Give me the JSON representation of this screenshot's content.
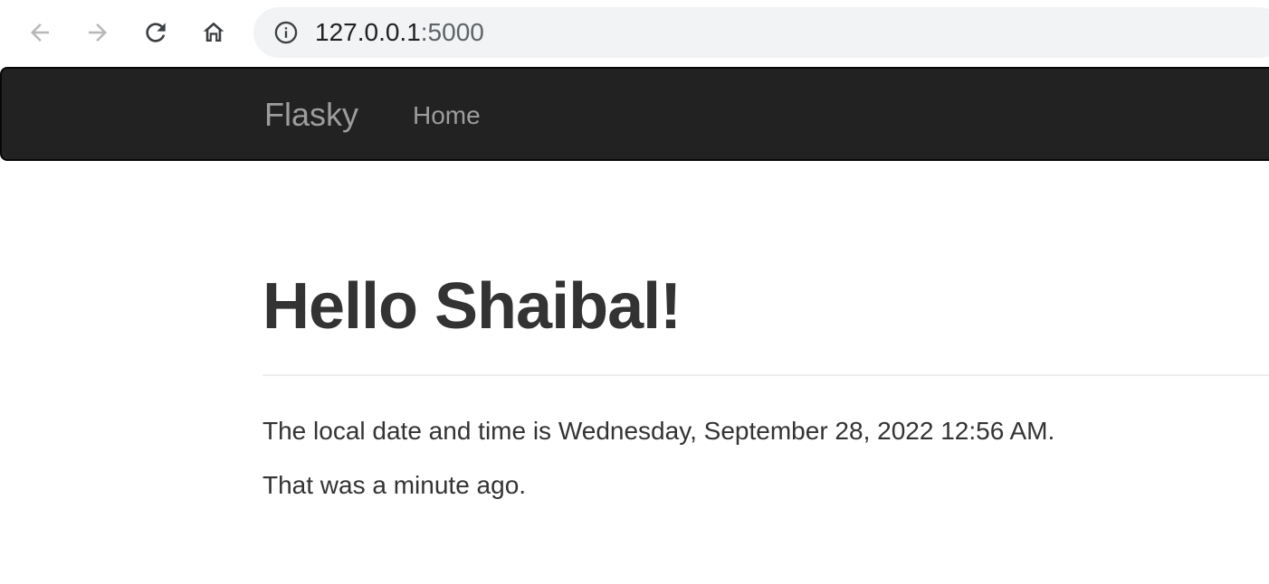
{
  "browser": {
    "url_host": "127.0.0.1",
    "url_port": ":5000",
    "icons": {
      "back": "arrow-left-icon",
      "forward": "arrow-right-icon",
      "reload": "reload-icon",
      "home": "home-icon",
      "info": "info-icon"
    }
  },
  "navbar": {
    "brand": "Flasky",
    "links": [
      {
        "label": "Home"
      }
    ],
    "background": "#222222"
  },
  "main": {
    "heading": "Hello Shaibal!",
    "local_time_text": "The local date and time is Wednesday, September 28, 2022 12:56 AM.",
    "relative_time_text": "That was a minute ago."
  },
  "colors": {
    "text": "#333333",
    "nav_text": "#9d9d9d",
    "omnibox_bg": "#f1f3f4"
  }
}
